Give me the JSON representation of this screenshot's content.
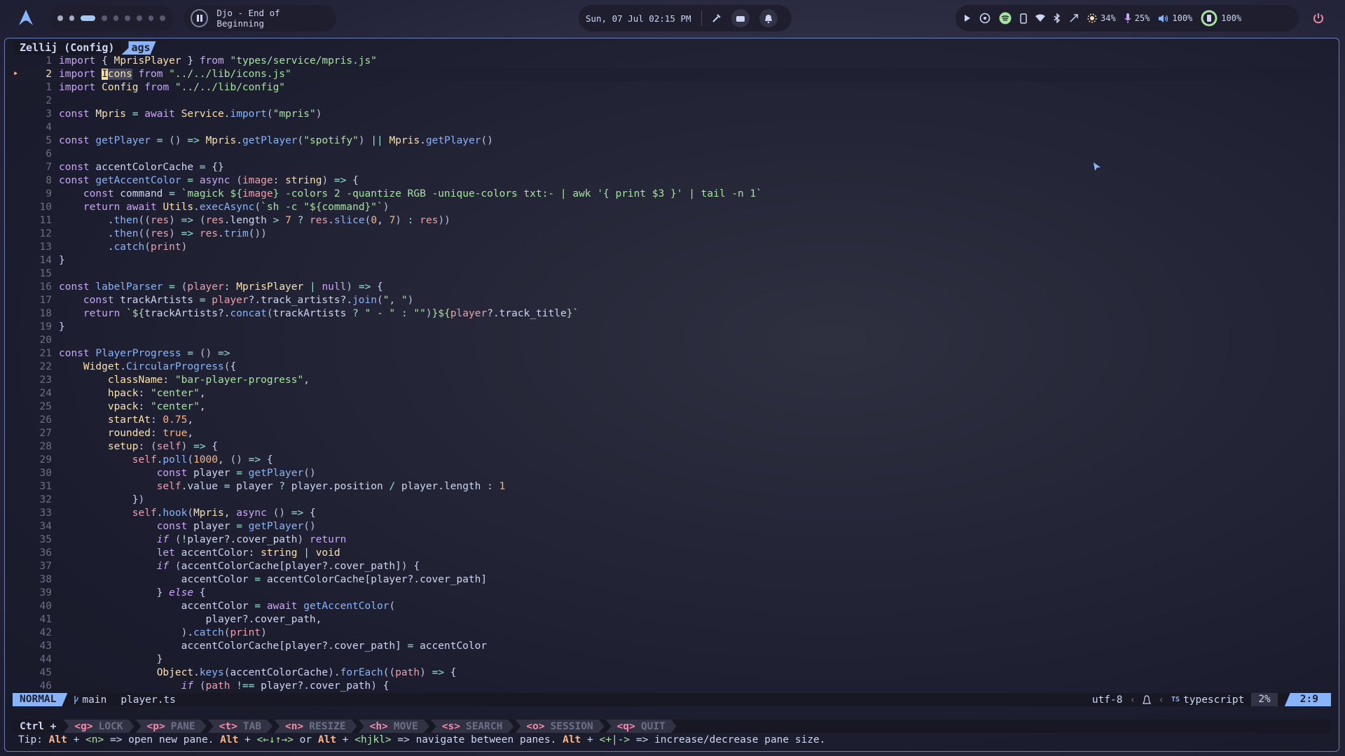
{
  "topbar": {
    "media": {
      "title": "Djo - End of Beginning"
    },
    "clock": "Sun, 07 Jul 02:15 PM",
    "system": {
      "brightness": "34%",
      "mic": "25%",
      "volume": "100%",
      "battery": "100%"
    }
  },
  "pane": {
    "title": "Zellij (Config)",
    "tab": "ags"
  },
  "editor": {
    "lines": [
      {
        "n": "1",
        "html": "<span class=\"kw\">import</span> { <span class=\"ty\">MprisPlayer</span> } <span class=\"kw\">from</span> <span class=\"str\">\"types/service/mpris.js\"</span>"
      },
      {
        "n": "2",
        "cur": true,
        "html": "<span class=\"kw\">import</span> <span class=\"ty\"><span class=\"cursor\">I</span><span class=\"match\">cons</span></span> <span class=\"kw\">from</span> <span class=\"str\">\"../../lib/icons.js\"</span>"
      },
      {
        "n": "1",
        "html": "<span class=\"kw\">import</span> <span class=\"ty\">Config</span> <span class=\"kw\">from</span> <span class=\"str\">\"../../lib/config\"</span>"
      },
      {
        "n": "2",
        "html": ""
      },
      {
        "n": "3",
        "html": "<span class=\"kw\">const</span> <span class=\"ty\">Mpris</span> <span class=\"op\">=</span> <span class=\"kw\">await</span> <span class=\"ty\">Service</span>.<span class=\"fn\">import</span><span class=\"pr\">(</span><span class=\"str\">\"mpris\"</span><span class=\"pr\">)</span>"
      },
      {
        "n": "4",
        "html": ""
      },
      {
        "n": "5",
        "html": "<span class=\"kw\">const</span> <span class=\"fn\">getPlayer</span> <span class=\"op\">=</span> <span class=\"pr\">()</span> <span class=\"op\">=&gt;</span> <span class=\"ty\">Mpris</span>.<span class=\"fn\">getPlayer</span><span class=\"pr\">(</span><span class=\"str\">\"spotify\"</span><span class=\"pr\">)</span> <span class=\"op\">||</span> <span class=\"ty\">Mpris</span>.<span class=\"fn\">getPlayer</span><span class=\"pr\">()</span>"
      },
      {
        "n": "6",
        "html": ""
      },
      {
        "n": "7",
        "html": "<span class=\"kw\">const</span> accentColorCache <span class=\"op\">=</span> {}"
      },
      {
        "n": "8",
        "html": "<span class=\"kw\">const</span> <span class=\"fn\">getAccentColor</span> <span class=\"op\">=</span> <span class=\"kw\">async</span> <span class=\"pr\">(</span><span class=\"pm\">image</span>: <span class=\"ty\">string</span><span class=\"pr\">)</span> <span class=\"op\">=&gt;</span> {"
      },
      {
        "n": "9",
        "html": "    <span class=\"kw\">const</span> command <span class=\"op\">=</span> <span class=\"str\">`magick ${</span><span class=\"pm\">image</span><span class=\"str\">} -colors 2 -quantize RGB -unique-colors txt:- | awk '{ print $3 }' | tail -n 1`</span>"
      },
      {
        "n": "10",
        "html": "    <span class=\"kw\">return</span> <span class=\"kw\">await</span> <span class=\"ty\">Utils</span>.<span class=\"fn\">execAsync</span><span class=\"pr\">(</span><span class=\"str\">`sh -c \"${command}\"`</span><span class=\"pr\">)</span>"
      },
      {
        "n": "11",
        "html": "        .<span class=\"fn\">then</span><span class=\"pr\">((</span><span class=\"pm\">res</span><span class=\"pr\">)</span> <span class=\"op\">=&gt;</span> <span class=\"pr\">(</span><span class=\"pm\">res</span>.length <span class=\"op\">&gt;</span> <span class=\"nm\">7</span> <span class=\"op\">?</span> <span class=\"pm\">res</span>.<span class=\"fn\">slice</span><span class=\"pr\">(</span><span class=\"nm\">0</span>, <span class=\"nm\">7</span><span class=\"pr\">)</span> <span class=\"op\">:</span> <span class=\"pm\">res</span><span class=\"pr\">))</span>"
      },
      {
        "n": "12",
        "html": "        .<span class=\"fn\">then</span><span class=\"pr\">((</span><span class=\"pm\">res</span><span class=\"pr\">)</span> <span class=\"op\">=&gt;</span> <span class=\"pm\">res</span>.<span class=\"fn\">trim</span><span class=\"pr\">())</span>"
      },
      {
        "n": "13",
        "html": "        .<span class=\"fn\">catch</span><span class=\"pr\">(</span><span class=\"pm\">print</span><span class=\"pr\">)</span>"
      },
      {
        "n": "14",
        "html": "}"
      },
      {
        "n": "15",
        "html": ""
      },
      {
        "n": "16",
        "html": "<span class=\"kw\">const</span> <span class=\"fn\">labelParser</span> <span class=\"op\">=</span> <span class=\"pr\">(</span><span class=\"pm\">player</span>: <span class=\"ty\">MprisPlayer</span> <span class=\"op\">|</span> <span class=\"kw\">null</span><span class=\"pr\">)</span> <span class=\"op\">=&gt;</span> {"
      },
      {
        "n": "17",
        "html": "    <span class=\"kw\">const</span> trackArtists <span class=\"op\">=</span> <span class=\"pm\">player</span>?.track_artists?.<span class=\"fn\">join</span><span class=\"pr\">(</span><span class=\"str\">\", \"</span><span class=\"pr\">)</span>"
      },
      {
        "n": "18",
        "html": "    <span class=\"kw\">return</span> <span class=\"str\">`${</span>trackArtists?.<span class=\"fn\">concat</span><span class=\"pr\">(</span>trackArtists <span class=\"op\">?</span> <span class=\"str\">\" - \"</span> <span class=\"op\">:</span> <span class=\"str\">\"\"</span><span class=\"pr\">)</span><span class=\"str\">}${</span><span class=\"pm\">player</span>?.track_title<span class=\"str\">}`</span>"
      },
      {
        "n": "19",
        "html": "}"
      },
      {
        "n": "20",
        "html": ""
      },
      {
        "n": "21",
        "html": "<span class=\"kw\">const</span> <span class=\"fn\">PlayerProgress</span> <span class=\"op\">=</span> <span class=\"pr\">()</span> <span class=\"op\">=&gt;</span>"
      },
      {
        "n": "22",
        "html": "    <span class=\"ty\">Widget</span>.<span class=\"fn\">CircularProgress</span><span class=\"pr\">(</span>{"
      },
      {
        "n": "23",
        "html": "        <span class=\"ty\">className</span>: <span class=\"str\">\"bar-player-progress\"</span>,"
      },
      {
        "n": "24",
        "html": "        <span class=\"ty\">hpack</span>: <span class=\"str\">\"center\"</span>,"
      },
      {
        "n": "25",
        "html": "        <span class=\"ty\">vpack</span>: <span class=\"str\">\"center\"</span>,"
      },
      {
        "n": "26",
        "html": "        <span class=\"ty\">startAt</span>: <span class=\"nm\">0.75</span>,"
      },
      {
        "n": "27",
        "html": "        <span class=\"ty\">rounded</span>: <span class=\"nm\">true</span>,"
      },
      {
        "n": "28",
        "html": "        <span class=\"ty\">setup</span>: <span class=\"pr\">(</span><span class=\"pm\">self</span><span class=\"pr\">)</span> <span class=\"op\">=&gt;</span> {"
      },
      {
        "n": "29",
        "html": "            <span class=\"pm\">self</span>.<span class=\"fn\">poll</span><span class=\"pr\">(</span><span class=\"nm\">1000</span>, <span class=\"pr\">()</span> <span class=\"op\">=&gt;</span> {"
      },
      {
        "n": "30",
        "html": "                <span class=\"kw\">const</span> player <span class=\"op\">=</span> <span class=\"fn\">getPlayer</span><span class=\"pr\">()</span>"
      },
      {
        "n": "31",
        "html": "                <span class=\"pm\">self</span>.value <span class=\"op\">=</span> player <span class=\"op\">?</span> player.position <span class=\"op\">/</span> player.length <span class=\"op\">:</span> <span class=\"nm\">1</span>"
      },
      {
        "n": "32",
        "html": "            }<span class=\"pr\">)</span>"
      },
      {
        "n": "33",
        "html": "            <span class=\"pm\">self</span>.<span class=\"fn\">hook</span><span class=\"pr\">(</span><span class=\"ty\">Mpris</span>, <span class=\"kw\">async</span> <span class=\"pr\">()</span> <span class=\"op\">=&gt;</span> {"
      },
      {
        "n": "34",
        "html": "                <span class=\"kw\">const</span> player <span class=\"op\">=</span> <span class=\"fn\">getPlayer</span><span class=\"pr\">()</span>"
      },
      {
        "n": "35",
        "html": "                <span class=\"it\">if</span> <span class=\"pr\">(</span><span class=\"op\">!</span>player?.cover_path<span class=\"pr\">)</span> <span class=\"kw\">return</span>"
      },
      {
        "n": "36",
        "html": "                <span class=\"kw\">let</span> accentColor: <span class=\"ty\">string</span> <span class=\"op\">|</span> <span class=\"ty\">void</span>"
      },
      {
        "n": "37",
        "html": "                <span class=\"it\">if</span> <span class=\"pr\">(</span>accentColorCache[player?.cover_path]<span class=\"pr\">)</span> {"
      },
      {
        "n": "38",
        "html": "                    accentColor <span class=\"op\">=</span> accentColorCache[player?.cover_path]"
      },
      {
        "n": "39",
        "html": "                } <span class=\"it\">else</span> {"
      },
      {
        "n": "40",
        "html": "                    accentColor <span class=\"op\">=</span> <span class=\"kw\">await</span> <span class=\"fn\">getAccentColor</span><span class=\"pr\">(</span>"
      },
      {
        "n": "41",
        "html": "                        player?.cover_path,"
      },
      {
        "n": "42",
        "html": "                    <span class=\"pr\">)</span>.<span class=\"fn\">catch</span><span class=\"pr\">(</span><span class=\"pm\">print</span><span class=\"pr\">)</span>"
      },
      {
        "n": "43",
        "html": "                    accentColorCache[player?.cover_path] <span class=\"op\">=</span> accentColor"
      },
      {
        "n": "44",
        "html": "                }"
      },
      {
        "n": "45",
        "html": "                <span class=\"ty\">Object</span>.<span class=\"fn\">keys</span><span class=\"pr\">(</span>accentColorCache<span class=\"pr\">)</span>.<span class=\"fn\">forEach</span><span class=\"pr\">((</span><span class=\"pm\">path</span><span class=\"pr\">)</span> <span class=\"op\">=&gt;</span> {"
      },
      {
        "n": "46",
        "html": "                    <span class=\"it\">if</span> <span class=\"pr\">(</span><span class=\"pm\">path</span> <span class=\"op\">!==</span> player?.cover_path<span class=\"pr\">)</span> {"
      }
    ]
  },
  "statusline": {
    "mode": "NORMAL",
    "branch": "main",
    "filename": "player.ts",
    "encoding": "utf-8",
    "filetype": "typescript",
    "percent": "2%",
    "position": "2:9"
  },
  "zellij": {
    "ctrl": "Ctrl +",
    "keys": [
      {
        "key": "<g>",
        "label": "LOCK"
      },
      {
        "key": "<p>",
        "label": "PANE"
      },
      {
        "key": "<t>",
        "label": "TAB"
      },
      {
        "key": "<n>",
        "label": "RESIZE"
      },
      {
        "key": "<h>",
        "label": "MOVE"
      },
      {
        "key": "<s>",
        "label": "SEARCH"
      },
      {
        "key": "<o>",
        "label": "SESSION"
      },
      {
        "key": "<q>",
        "label": "QUIT"
      }
    ],
    "tip": {
      "t0": "Tip: ",
      "alt": "Alt",
      " p1": " + ",
      "k1": "<n>",
      "p2": " => open new pane. ",
      "k2": "<←↓↑→>",
      "p3": " or ",
      "k3": "<hjkl>",
      "p4": " => navigate between panes. ",
      "k4": "<+|->",
      "p5": " => increase/decrease pane size."
    }
  },
  "colors": {
    "accent": "#89b4fa",
    "background": "#1e1e2e",
    "text": "#cdd6f4"
  }
}
